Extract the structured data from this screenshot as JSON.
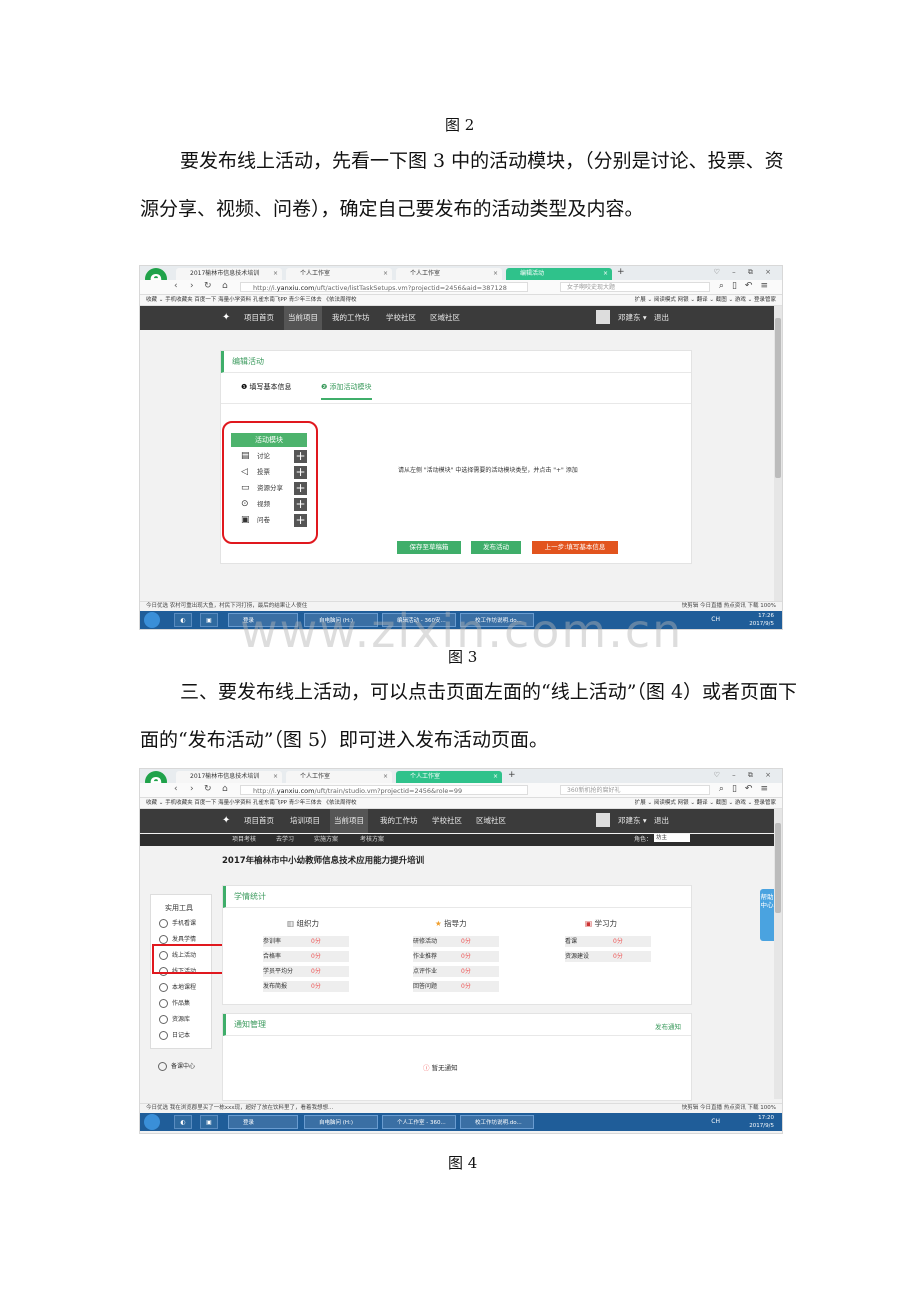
{
  "captions": {
    "fig2": "图 2",
    "fig3": "图 3",
    "fig4": "图 4"
  },
  "paragraphs": {
    "p1": "要发布线上活动，先看一下图 3 中的活动模块，（分别是讨论、投票、资源分享、视频、问卷），确定自己要发布的活动类型及内容。",
    "p2": "三、要发布线上活动，可以点击页面左面的“线上活动”（图 4）或者页面下面的“发布活动”（图 5）即可进入发布活动页面。"
  },
  "watermark": "www.zixin.com.cn",
  "shot1": {
    "tabs": [
      "2017榆林市信息技术培训",
      "个人工作室",
      "个人工作室",
      "编辑活动"
    ],
    "url_prefix": "http://i.",
    "url_domain": "yanxiu.com",
    "url_path": "/uft/active/listTaskSetups.vm?projectid=2456&aid=387128",
    "search_text": "女子啊咬史现大题",
    "fav_left": "收藏 ⌄  手机收藏夹  百度一下  海量小学资料  孔雀东南飞PP  青少年三体去  《依法周得校",
    "fav_right": "扩展 ⌄  阅读模式  网银 ⌄  翻译 ⌄  截图 ⌄  游戏 ⌄  登录管家",
    "nav": [
      "项目首页",
      "当前项目",
      "我的工作坊",
      "学校社区",
      "区域社区"
    ],
    "user_name": "邓建东 ▾",
    "logout": "退出",
    "panel_title": "编辑活动",
    "step1": "❶ 填写基本信息",
    "step2": "❷ 添加活动模块",
    "module_head": "活动模块",
    "modules": [
      {
        "icon": "discuss-icon",
        "label": "讨论"
      },
      {
        "icon": "vote-icon",
        "label": "投票"
      },
      {
        "icon": "resource-icon",
        "label": "资源分享"
      },
      {
        "icon": "video-icon",
        "label": "视频"
      },
      {
        "icon": "survey-icon",
        "label": "问卷"
      }
    ],
    "hint": "请从左侧 \"活动模块\" 中选择需要的活动模块类型，并点击 \"+\" 添加",
    "buttons": {
      "save": "保存至草稿箱",
      "publish": "发布活动",
      "prev": "上一步:填写基本信息"
    },
    "status_left": "今日优选   农村可重出现大鱼，村民下河打捞，最后的结果让人傻住",
    "status_right": "快剪辑  今日直播  热点资讯      下载         100%",
    "taskbar": {
      "qq": "登录",
      "app2": "自电脑问 (H:)",
      "app3": "编辑活动 - 360安...",
      "app4": "校工作坊说明.do...",
      "tray_lang": "CH",
      "time": "17:26",
      "date": "2017/9/5"
    }
  },
  "shot2": {
    "tabs": [
      "2017榆林市信息技术培训",
      "个人工作室",
      "个人工作室"
    ],
    "url_prefix": "http://i.",
    "url_domain": "yanxiu.com",
    "url_path": "/uft/train/studio.vm?projectid=2456&role=99",
    "search_text": "360新机抢的腐好礼",
    "nav": [
      "项目首页",
      "培训项目",
      "当前项目",
      "我的工作坊",
      "学校社区",
      "区域社区"
    ],
    "user_name": "邓建东 ▾",
    "logout": "退出",
    "subnav": [
      "项目考核",
      "去学习",
      "实施方案",
      "考核方案"
    ],
    "role_label": "角色：",
    "role_value": "坊主",
    "page_title": "2017年榆林市中小幼教师信息技术应用能力提升培训",
    "tools_title": "实用工具",
    "tools": [
      "手机看课",
      "发具学情",
      "线上活动",
      "线下活动",
      "本地课程",
      "作品集",
      "资源库",
      "日记本",
      "备课中心"
    ],
    "stat_title": "学情统计",
    "groups": [
      {
        "title": "组织力",
        "rows": [
          [
            "参训率",
            "0分"
          ],
          [
            "合格率",
            "0分"
          ],
          [
            "学员平均分",
            "0分"
          ],
          [
            "发布简报",
            "0分"
          ]
        ]
      },
      {
        "title": "指导力",
        "rows": [
          [
            "研修活动",
            "0分"
          ],
          [
            "作业推荐",
            "0分"
          ],
          [
            "点评作业",
            "0分"
          ],
          [
            "回答问题",
            "0分"
          ]
        ]
      },
      {
        "title": "学习力",
        "rows": [
          [
            "看课",
            "0分"
          ],
          [
            "资源建设",
            "0分"
          ]
        ]
      }
    ],
    "notice_title": "通知管理",
    "notice_publish": "发布通知",
    "notice_empty": "暂无通知",
    "help": "帮助中心",
    "status_left": "今日优选   我在浏览郡里买了一栋xxx现，超好了放在饮料里了，看着我想想...",
    "status_right": "快剪辑  今日直播  热点资讯      下载         100%",
    "taskbar": {
      "qq": "登录",
      "app2": "自电脑问 (H:)",
      "app3": "个人工作室 - 360...",
      "app4": "校工作坊说明.do...",
      "tray_lang": "CH",
      "time": "17:20",
      "date": "2017/9/5"
    }
  }
}
